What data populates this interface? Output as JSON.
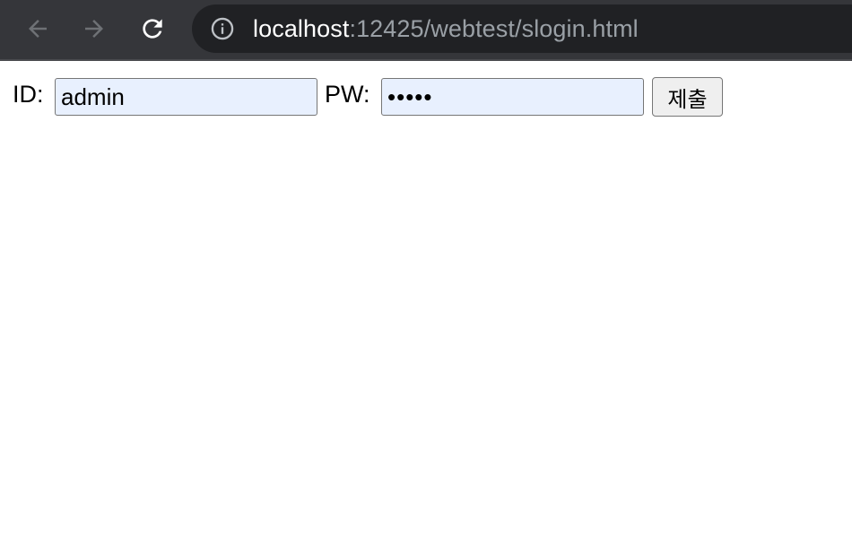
{
  "browser": {
    "url_host": "localhost",
    "url_rest": ":12425/webtest/slogin.html",
    "icons": {
      "back": "arrow-left-icon",
      "forward": "arrow-right-icon",
      "reload": "reload-icon",
      "site_info": "info-circle-icon"
    }
  },
  "login_form": {
    "id_label": "ID:",
    "id_value": "admin",
    "pw_label": "PW:",
    "pw_value": "•••••",
    "submit_label": "제출"
  },
  "colors": {
    "toolbar_bg": "#35363a",
    "omnibox_bg": "#202124",
    "autofill_bg": "#e8f0fe"
  }
}
